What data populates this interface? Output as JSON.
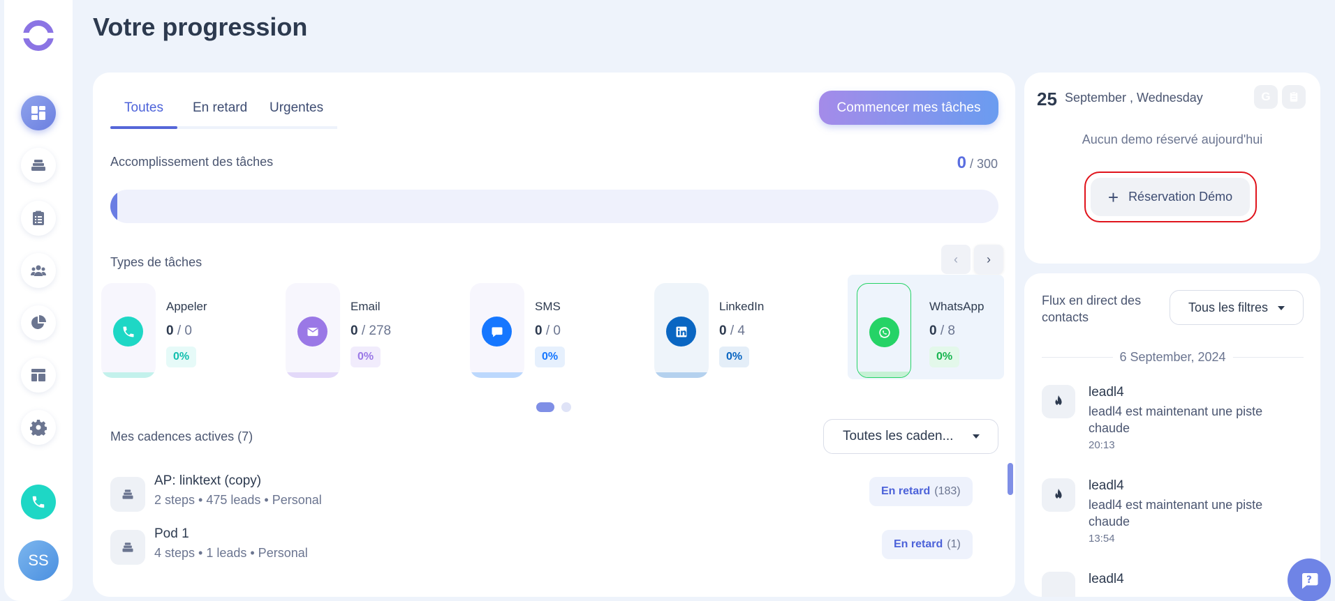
{
  "page": {
    "title": "Votre progression"
  },
  "sidebar": {
    "items": [
      {
        "name": "dashboard-icon",
        "active": true
      },
      {
        "name": "cadences-icon"
      },
      {
        "name": "tasks-clipboard-icon"
      },
      {
        "name": "contacts-group-icon"
      },
      {
        "name": "analytics-pie-icon"
      },
      {
        "name": "templates-layout-icon"
      },
      {
        "name": "settings-gear-icon"
      }
    ],
    "phone_icon": "phone-icon",
    "avatar_initials": "SS"
  },
  "tabs": [
    {
      "label": "Toutes",
      "active": true
    },
    {
      "label": "En retard"
    },
    {
      "label": "Urgentes"
    }
  ],
  "cta_label": "Commencer mes tâches",
  "completion": {
    "label": "Accomplissement des tâches",
    "done": "0",
    "total": "/ 300",
    "progress": 0.008
  },
  "task_types": {
    "label": "Types de tâches",
    "items": [
      {
        "name": "Appeler",
        "done": "0",
        "total": "/ 0",
        "pct": "0%",
        "color": "#1ed7c5",
        "pct_bg": "#e6faf8",
        "pct_color": "#12bfae",
        "bar": "#c3f1ec"
      },
      {
        "name": "Email",
        "done": "0",
        "total": "/ 278",
        "pct": "0%",
        "color": "#9a78e6",
        "pct_bg": "#f1ecfc",
        "pct_color": "#9a78e6",
        "bar": "#e3d9f9"
      },
      {
        "name": "SMS",
        "done": "0",
        "total": "/ 0",
        "pct": "0%",
        "color": "#1677ff",
        "pct_bg": "#e6f0fd",
        "pct_color": "#1677ff",
        "bar": "#bcd8fd"
      },
      {
        "name": "LinkedIn",
        "done": "0",
        "total": "/ 4",
        "pct": "0%",
        "color": "#0a66c2",
        "pct_bg": "#e4eef8",
        "pct_color": "#0a66c2",
        "bar": "#b4d1ee"
      },
      {
        "name": "WhatsApp",
        "done": "0",
        "total": "/ 8",
        "pct": "0%",
        "color": "#25d366",
        "pct_bg": "#e3f8ea",
        "pct_color": "#18b550",
        "bar": "#c6f1d5",
        "selected": true
      }
    ]
  },
  "cadences": {
    "label": "Mes cadences actives (7)",
    "filter": "Toutes les caden...",
    "rows": [
      {
        "name": "AP: linktext (copy)",
        "meta": "2 steps • 475 leads • Personal",
        "late_label": "En retard",
        "late_count": "(183)"
      },
      {
        "name": "Pod 1",
        "meta": "4 steps • 1 leads • Personal",
        "late_label": "En retard",
        "late_count": "(1)"
      }
    ]
  },
  "calendar": {
    "day": "25",
    "date": "September , Wednesday",
    "google_letter": "G",
    "empty_text": "Aucun demo réservé aujourd'hui",
    "demo_button": "Réservation Démo"
  },
  "feed": {
    "title": "Flux en direct des contacts",
    "filter": "Tous les filtres",
    "date": "6 September, 2024",
    "items": [
      {
        "name": "leadl4",
        "text": "leadl4 est maintenant une piste chaude",
        "time": "20:13"
      },
      {
        "name": "leadl4",
        "text": "leadl4 est maintenant une piste chaude",
        "time": "13:54"
      },
      {
        "name": "leadl4",
        "text": "",
        "time": ""
      }
    ]
  }
}
